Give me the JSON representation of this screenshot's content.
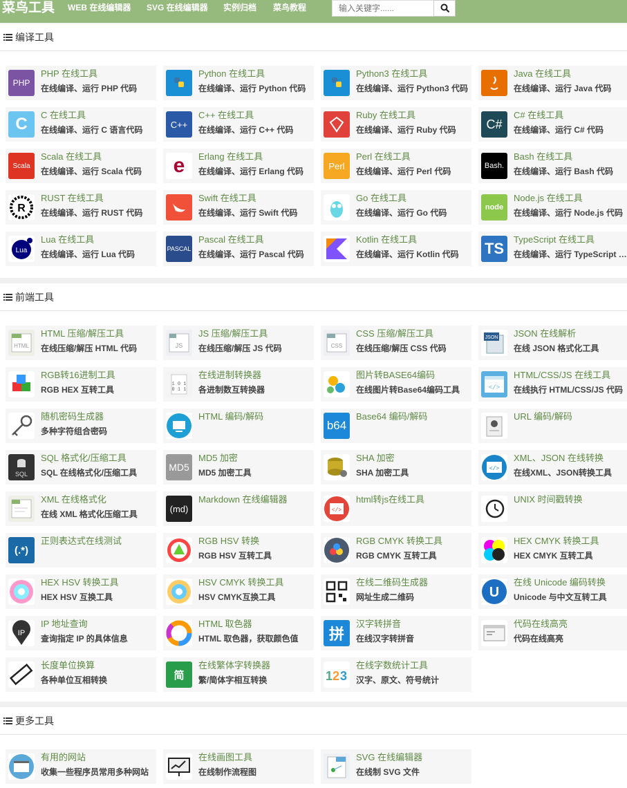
{
  "header": {
    "logo": "菜鸟工具",
    "nav": [
      "WEB 在线编辑器",
      "SVG 在线编辑器",
      "实例归档",
      "菜鸟教程"
    ],
    "search_placeholder": "输入关键字......"
  },
  "colors": {
    "header_bg": "#96b97d",
    "card_title": "#5e8a44",
    "card_bg": "#f6f6f6"
  },
  "sections": [
    {
      "title": "编译工具",
      "items": [
        {
          "title": "PHP 在线工具",
          "desc": "在线编译、运行 PHP 代码",
          "icon": "php-icon"
        },
        {
          "title": "Python 在线工具",
          "desc": "在线编译、运行 Python 代码",
          "icon": "python-icon"
        },
        {
          "title": "Python3 在线工具",
          "desc": "在线编译、运行 Python3 代码",
          "icon": "python3-icon"
        },
        {
          "title": "Java 在线工具",
          "desc": "在线编译、运行 Java 代码",
          "icon": "java-icon"
        },
        {
          "title": "C 在线工具",
          "desc": "在线编译、运行 C 语言代码",
          "icon": "c-icon"
        },
        {
          "title": "C++ 在线工具",
          "desc": "在线编译、运行 C++ 代码",
          "icon": "cpp-icon"
        },
        {
          "title": "Ruby 在线工具",
          "desc": "在线编译、运行 Ruby 代码",
          "icon": "ruby-icon"
        },
        {
          "title": "C# 在线工具",
          "desc": "在线编译、运行 C# 代码",
          "icon": "csharp-icon"
        },
        {
          "title": "Scala 在线工具",
          "desc": "在线编译、运行 Scala 代码",
          "icon": "scala-icon"
        },
        {
          "title": "Erlang 在线工具",
          "desc": "在线编译、运行 Erlang 代码",
          "icon": "erlang-icon"
        },
        {
          "title": "Perl 在线工具",
          "desc": "在线编译、运行 Perl 代码",
          "icon": "perl-icon"
        },
        {
          "title": "Bash 在线工具",
          "desc": "在线编译、运行 Bash 代码",
          "icon": "bash-icon"
        },
        {
          "title": "RUST 在线工具",
          "desc": "在线编译、运行 RUST 代码",
          "icon": "rust-icon"
        },
        {
          "title": "Swift 在线工具",
          "desc": "在线编译、运行 Swift 代码",
          "icon": "swift-icon"
        },
        {
          "title": "Go 在线工具",
          "desc": "在线编译、运行 Go 代码",
          "icon": "go-icon"
        },
        {
          "title": "Node.js 在线工具",
          "desc": "在线编译、运行 Node.js 代码",
          "icon": "nodejs-icon"
        },
        {
          "title": "Lua 在线工具",
          "desc": "在线编译、运行 Lua 代码",
          "icon": "lua-icon"
        },
        {
          "title": "Pascal 在线工具",
          "desc": "在线编译、运行 Pascal 代码",
          "icon": "pascal-icon"
        },
        {
          "title": "Kotlin 在线工具",
          "desc": "在线编译、运行 Kotlin 代码",
          "icon": "kotlin-icon"
        },
        {
          "title": "TypeScript 在线工具",
          "desc": "在线编译、运行 TypeScript 代码",
          "icon": "typescript-icon"
        }
      ]
    },
    {
      "title": "前端工具",
      "items": [
        {
          "title": "HTML 压缩/解压工具",
          "desc": "在线压缩/解压 HTML 代码",
          "icon": "html-compress-icon"
        },
        {
          "title": "JS 压缩/解压工具",
          "desc": "在线压缩/解压 JS 代码",
          "icon": "js-compress-icon"
        },
        {
          "title": "CSS 压缩/解压工具",
          "desc": "在线压缩/解压 CSS 代码",
          "icon": "css-compress-icon"
        },
        {
          "title": "JSON 在线解析",
          "desc": "在线 JSON 格式化工具",
          "icon": "json-icon"
        },
        {
          "title": "RGB转16进制工具",
          "desc": "RGB HEX 互转工具",
          "icon": "rgb-cubes-icon"
        },
        {
          "title": "在线进制转换器",
          "desc": "各进制数互转换器",
          "icon": "binary-icon"
        },
        {
          "title": "图片转BASE64编码",
          "desc": "在线图片转Base64编码工具",
          "icon": "gears-icon"
        },
        {
          "title": "HTML/CSS/JS 在线工具",
          "desc": "在线执行 HTML/CSS/JS 代码",
          "icon": "code-window-icon"
        },
        {
          "title": "随机密码生成器",
          "desc": "多种字符组合密码",
          "icon": "key-icon"
        },
        {
          "title": "HTML 编码/解码",
          "desc": "",
          "icon": "monitor-icon"
        },
        {
          "title": "Base64 编码/解码",
          "desc": "",
          "icon": "b64-icon"
        },
        {
          "title": "URL 编码/解码",
          "desc": "",
          "icon": "url-doc-icon"
        },
        {
          "title": "SQL 格式化/压缩工具",
          "desc": "SQL 在线格式化/压缩工具",
          "icon": "sql-icon"
        },
        {
          "title": "MD5 加密",
          "desc": "MD5 加密工具",
          "icon": "md5-icon"
        },
        {
          "title": "SHA 加密",
          "desc": "SHA 加密工具",
          "icon": "database-key-icon"
        },
        {
          "title": "XML、JSON 在线转换",
          "desc": "在线XML、JSON转换工具",
          "icon": "xml-json-icon"
        },
        {
          "title": "XML 在线格式化",
          "desc": "在线 XML 格式化压缩工具",
          "icon": "xml-icon"
        },
        {
          "title": "Markdown 在线编辑器",
          "desc": "",
          "icon": "markdown-icon"
        },
        {
          "title": "html转js在线工具",
          "desc": "",
          "icon": "html-js-icon"
        },
        {
          "title": "UNIX 时间戳转换",
          "desc": "",
          "icon": "history-clock-icon"
        },
        {
          "title": "正则表达式在线测试",
          "desc": "",
          "icon": "regex-icon"
        },
        {
          "title": "RGB HSV 转换",
          "desc": "RGB HSV 互转工具",
          "icon": "rgb-hsv-icon"
        },
        {
          "title": "RGB CMYK 转换工具",
          "desc": "RGB CMYK 互转工具",
          "icon": "rgb-cmyk-icon"
        },
        {
          "title": "HEX CMYK 转换工具",
          "desc": "HEX CMYK 互转工具",
          "icon": "hex-cmyk-icon"
        },
        {
          "title": "HEX HSV 转换工具",
          "desc": "HEX HSV 互换工具",
          "icon": "hex-hsv-icon"
        },
        {
          "title": "HSV CMYK 转换工具",
          "desc": "HSV CMYK互换工具",
          "icon": "hsv-cmyk-icon"
        },
        {
          "title": "在线二维码生成器",
          "desc": "网址生成二维码",
          "icon": "qrcode-icon"
        },
        {
          "title": "在线 Unicode 编码转换",
          "desc": "Unicode 与中文互转工具",
          "icon": "unicode-icon"
        },
        {
          "title": "IP 地址查询",
          "desc": "查询指定 IP 的具体信息",
          "icon": "ip-pin-icon"
        },
        {
          "title": "HTML 取色器",
          "desc": "HTML 取色器，获取颜色值",
          "icon": "color-ring-icon"
        },
        {
          "title": "汉字转拼音",
          "desc": "在线汉字转拼音",
          "icon": "pinyin-icon"
        },
        {
          "title": "代码在线高亮",
          "desc": "代码在线高亮",
          "icon": "code-highlight-icon"
        },
        {
          "title": "长度单位换算",
          "desc": "各种单位互相转换",
          "icon": "ruler-icon"
        },
        {
          "title": "在线繁体字转换器",
          "desc": "繁/简体字相互转换",
          "icon": "traditional-chinese-icon"
        },
        {
          "title": "在线字数统计工具",
          "desc": "汉字、原文、符号统计",
          "icon": "count-123-icon"
        }
      ]
    },
    {
      "title": "更多工具",
      "items": [
        {
          "title": "有用的网站",
          "desc": "收集一些程序员常用多种网站",
          "icon": "website-icon"
        },
        {
          "title": "在线画图工具",
          "desc": "在线制作流程图",
          "icon": "drawing-icon"
        },
        {
          "title": "SVG 在线编辑器",
          "desc": "在线制 SVG 文件",
          "icon": "svg-editor-icon"
        }
      ]
    }
  ]
}
